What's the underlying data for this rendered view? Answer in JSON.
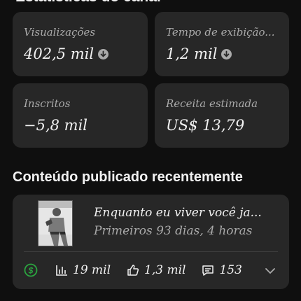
{
  "header": {
    "title": "Estatísticas do canal"
  },
  "stats": [
    {
      "label": "Visualizações",
      "value": "402,5 mil",
      "trend": "down",
      "icon": "arrow-down-circle-icon"
    },
    {
      "label": "Tempo de exibição...",
      "value": "1,2 mil",
      "trend": "down",
      "icon": "arrow-down-circle-icon"
    },
    {
      "label": "Inscritos",
      "value": "−5,8 mil"
    },
    {
      "label": "Receita estimada",
      "value": "US$ 13,79"
    }
  ],
  "recent": {
    "title": "Conteúdo publicado recentemente",
    "video": {
      "title": "Enquanto eu viver você ja...",
      "subtitle": "Primeiros 93 dias, 4 horas",
      "views": "19 mil",
      "likes": "1,3 mil",
      "comments": "153"
    }
  },
  "colors": {
    "monetization_green": "#2ba640",
    "card_bg": "#272727",
    "page_bg": "#0f0f0f"
  }
}
